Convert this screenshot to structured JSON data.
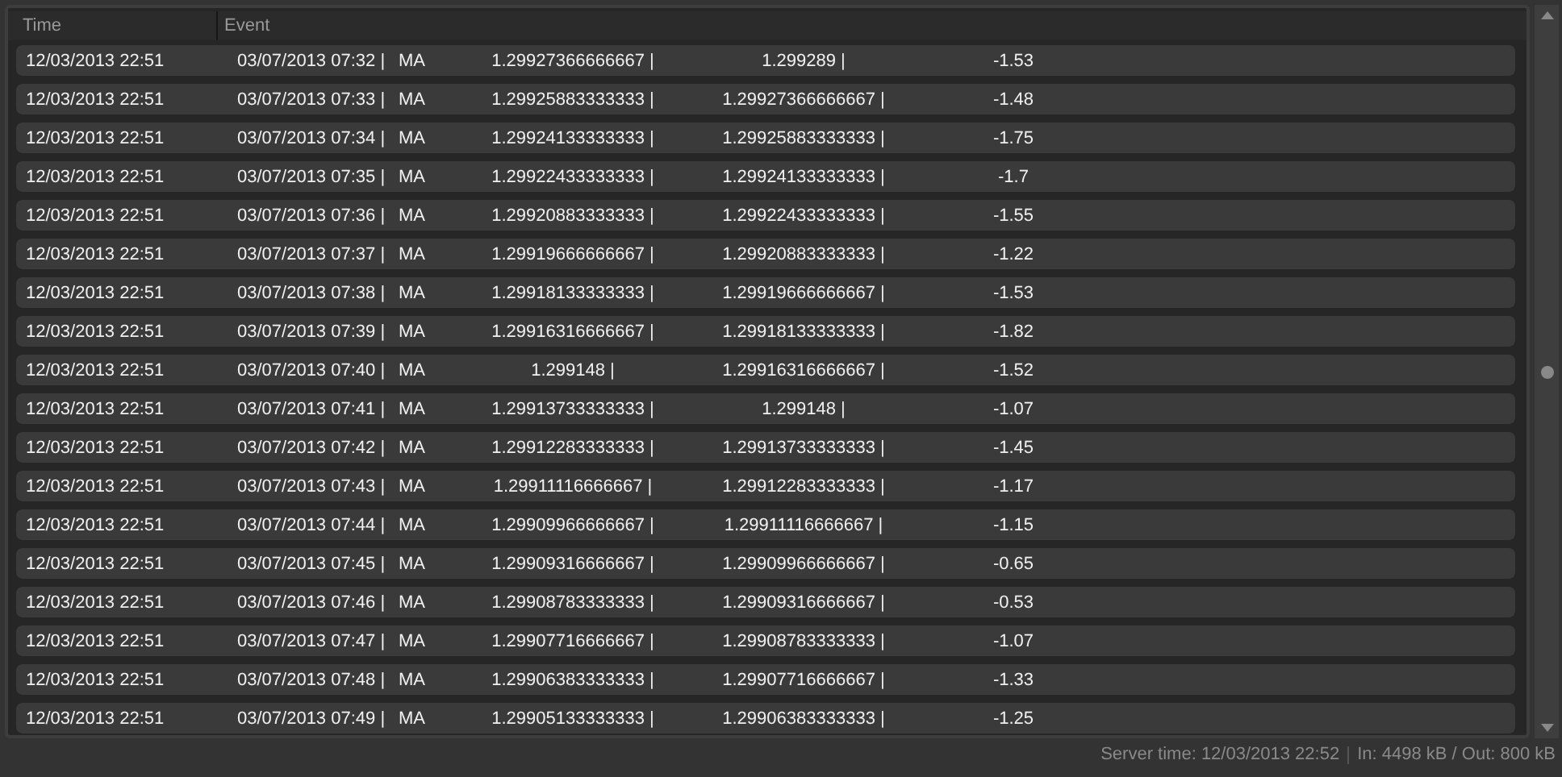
{
  "table": {
    "columns": [
      "Time",
      "Event"
    ],
    "rows": [
      {
        "time": "12/03/2013 22:51",
        "event_time": "03/07/2013 07:32 |",
        "symbol": "MA",
        "value_1": "1.29927366666667 |",
        "value_2": "1.299289 |",
        "change": "-1.53"
      },
      {
        "time": "12/03/2013 22:51",
        "event_time": "03/07/2013 07:33 |",
        "symbol": "MA",
        "value_1": "1.29925883333333 |",
        "value_2": "1.29927366666667 |",
        "change": "-1.48"
      },
      {
        "time": "12/03/2013 22:51",
        "event_time": "03/07/2013 07:34 |",
        "symbol": "MA",
        "value_1": "1.29924133333333 |",
        "value_2": "1.29925883333333 |",
        "change": "-1.75"
      },
      {
        "time": "12/03/2013 22:51",
        "event_time": "03/07/2013 07:35 |",
        "symbol": "MA",
        "value_1": "1.29922433333333 |",
        "value_2": "1.29924133333333 |",
        "change": "-1.7"
      },
      {
        "time": "12/03/2013 22:51",
        "event_time": "03/07/2013 07:36 |",
        "symbol": "MA",
        "value_1": "1.29920883333333 |",
        "value_2": "1.29922433333333 |",
        "change": "-1.55"
      },
      {
        "time": "12/03/2013 22:51",
        "event_time": "03/07/2013 07:37 |",
        "symbol": "MA",
        "value_1": "1.29919666666667 |",
        "value_2": "1.29920883333333 |",
        "change": "-1.22"
      },
      {
        "time": "12/03/2013 22:51",
        "event_time": "03/07/2013 07:38 |",
        "symbol": "MA",
        "value_1": "1.29918133333333 |",
        "value_2": "1.29919666666667 |",
        "change": "-1.53"
      },
      {
        "time": "12/03/2013 22:51",
        "event_time": "03/07/2013 07:39 |",
        "symbol": "MA",
        "value_1": "1.29916316666667 |",
        "value_2": "1.29918133333333 |",
        "change": "-1.82"
      },
      {
        "time": "12/03/2013 22:51",
        "event_time": "03/07/2013 07:40 |",
        "symbol": "MA",
        "value_1": "1.299148 |",
        "value_2": "1.29916316666667 |",
        "change": "-1.52"
      },
      {
        "time": "12/03/2013 22:51",
        "event_time": "03/07/2013 07:41 |",
        "symbol": "MA",
        "value_1": "1.29913733333333 |",
        "value_2": "1.299148 |",
        "change": "-1.07"
      },
      {
        "time": "12/03/2013 22:51",
        "event_time": "03/07/2013 07:42 |",
        "symbol": "MA",
        "value_1": "1.29912283333333 |",
        "value_2": "1.29913733333333 |",
        "change": "-1.45"
      },
      {
        "time": "12/03/2013 22:51",
        "event_time": "03/07/2013 07:43 |",
        "symbol": "MA",
        "value_1": "1.29911116666667 |",
        "value_2": "1.29912283333333 |",
        "change": "-1.17"
      },
      {
        "time": "12/03/2013 22:51",
        "event_time": "03/07/2013 07:44 |",
        "symbol": "MA",
        "value_1": "1.29909966666667 |",
        "value_2": "1.29911116666667 |",
        "change": "-1.15"
      },
      {
        "time": "12/03/2013 22:51",
        "event_time": "03/07/2013 07:45 |",
        "symbol": "MA",
        "value_1": "1.29909316666667 |",
        "value_2": "1.29909966666667 |",
        "change": "-0.65"
      },
      {
        "time": "12/03/2013 22:51",
        "event_time": "03/07/2013 07:46 |",
        "symbol": "MA",
        "value_1": "1.29908783333333 |",
        "value_2": "1.29909316666667 |",
        "change": "-0.53"
      },
      {
        "time": "12/03/2013 22:51",
        "event_time": "03/07/2013 07:47 |",
        "symbol": "MA",
        "value_1": "1.29907716666667 |",
        "value_2": "1.29908783333333 |",
        "change": "-1.07"
      },
      {
        "time": "12/03/2013 22:51",
        "event_time": "03/07/2013 07:48 |",
        "symbol": "MA",
        "value_1": "1.29906383333333 |",
        "value_2": "1.29907716666667 |",
        "change": "-1.33"
      },
      {
        "time": "12/03/2013 22:51",
        "event_time": "03/07/2013 07:49 |",
        "symbol": "MA",
        "value_1": "1.29905133333333 |",
        "value_2": "1.29906383333333 |",
        "change": "-1.25"
      }
    ]
  },
  "status_bar": {
    "server_time": "Server time: 12/03/2013 22:52",
    "traffic": "In: 4498 kB / Out: 800 kB"
  }
}
